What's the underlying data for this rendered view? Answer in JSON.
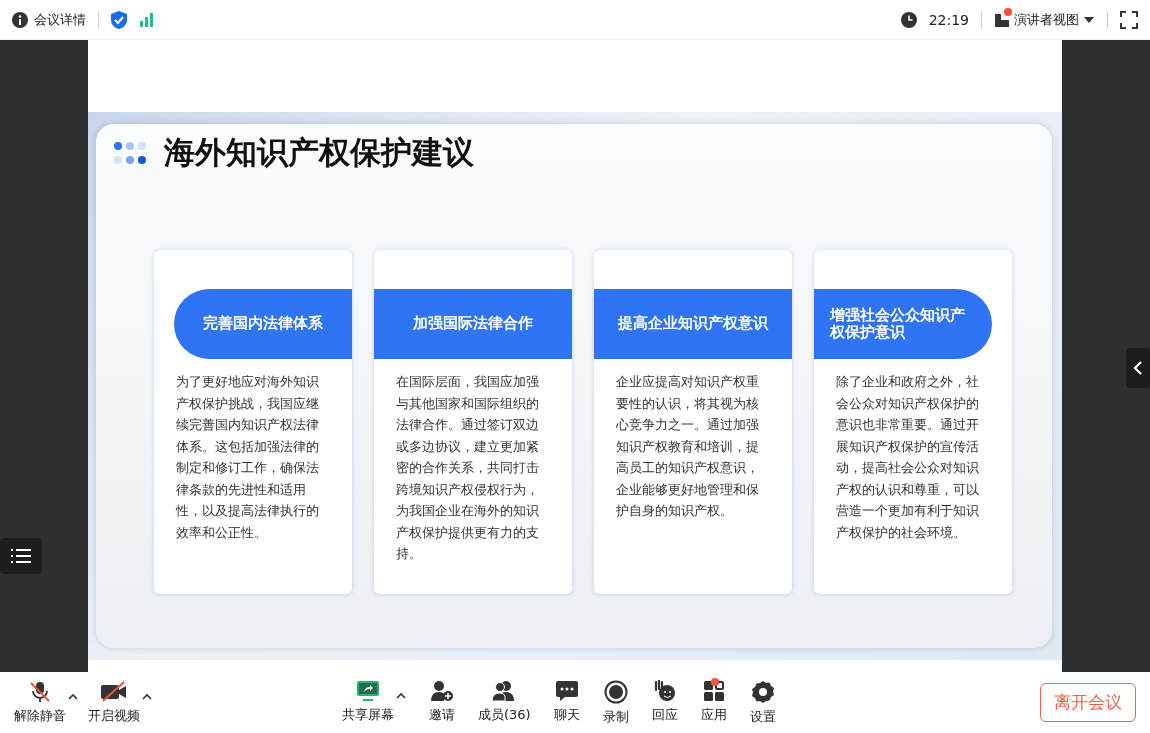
{
  "top_bar": {
    "meeting_info": "会议详情",
    "time": "22:19",
    "view_mode": {
      "label": "演讲者视图",
      "notification": true
    }
  },
  "slide": {
    "title": "海外知识产权保护建议",
    "cards": [
      {
        "heading": "完善国内法律体系",
        "kind": "pill-left",
        "body": "为了更好地应对海外知识产权保护挑战，我国应继续完善国内知识产权法律体系。这包括加强法律的制定和修订工作，确保法律条款的先进性和适用性，以及提高法律执行的效率和公正性。"
      },
      {
        "heading": "加强国际法律合作",
        "kind": "rect",
        "body": "在国际层面，我国应加强与其他国家和国际组织的法律合作。通过签订双边或多边协议，建立更加紧密的合作关系，共同打击跨境知识产权侵权行为，为我国企业在海外的知识产权保护提供更有力的支持。"
      },
      {
        "heading": "提高企业知识产权意识",
        "kind": "rect",
        "body": "企业应提高对知识产权重要性的认识，将其视为核心竞争力之一。通过加强知识产权教育和培训，提高员工的知识产权意识，企业能够更好地管理和保护自身的知识产权。"
      },
      {
        "heading": "增强社会公众知识产权保护意识",
        "kind": "pill-right",
        "body": "除了企业和政府之外，社会公众对知识产权保护的意识也非常重要。通过开展知识产权保护的宣传活动，提高社会公众对知识产权的认识和尊重，可以营造一个更加有利于知识产权保护的社会环境。"
      }
    ]
  },
  "toolbar": {
    "left": [
      {
        "kind": "mic",
        "label": "解除静音",
        "muted": true,
        "has_menu": true
      },
      {
        "kind": "video",
        "label": "开启视频",
        "muted": true,
        "has_menu": true
      }
    ],
    "center": [
      {
        "kind": "share",
        "label": "共享屏幕",
        "has_menu": true,
        "notification": false
      },
      {
        "kind": "invite",
        "label": "邀请",
        "has_menu": false,
        "notification": false
      },
      {
        "kind": "members",
        "label": "成员(36)",
        "has_menu": false,
        "notification": false
      },
      {
        "kind": "chat",
        "label": "聊天",
        "has_menu": false,
        "notification": false
      },
      {
        "kind": "record",
        "label": "录制",
        "has_menu": false,
        "notification": false
      },
      {
        "kind": "react",
        "label": "回应",
        "has_menu": false,
        "notification": false
      },
      {
        "kind": "apps",
        "label": "应用",
        "has_menu": false,
        "notification": true
      },
      {
        "kind": "settings",
        "label": "设置",
        "has_menu": false,
        "notification": false
      }
    ],
    "leave_button": "离开会议"
  }
}
